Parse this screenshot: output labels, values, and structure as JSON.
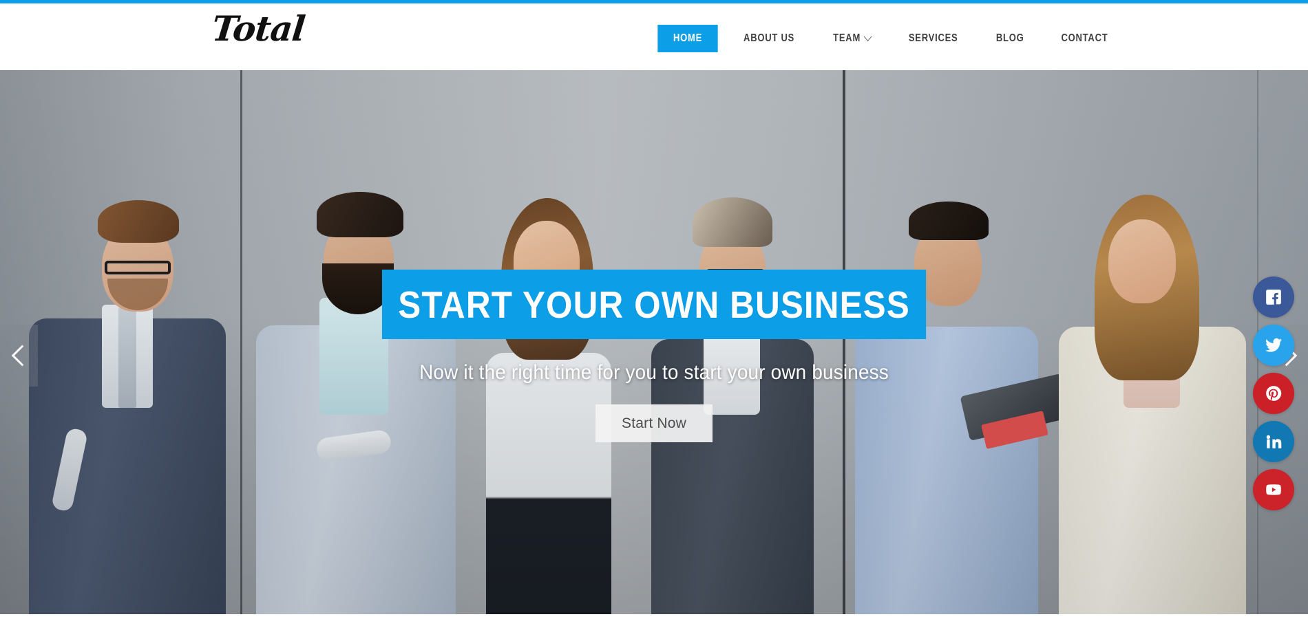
{
  "theme": {
    "accent_blue": "#0d9ee8",
    "nav_text": "#3f3f3f",
    "hero_title_bg": "#0d9ee8",
    "cta_bg": "#f3f3f3",
    "cta_text": "#4d4d4d"
  },
  "header": {
    "brand": "Total",
    "nav": [
      {
        "label": "HOME",
        "active": true,
        "has_dropdown": false
      },
      {
        "label": "ABOUT US",
        "active": false,
        "has_dropdown": false
      },
      {
        "label": "TEAM",
        "active": false,
        "has_dropdown": true
      },
      {
        "label": "SERVICES",
        "active": false,
        "has_dropdown": false
      },
      {
        "label": "BLOG",
        "active": false,
        "has_dropdown": false
      },
      {
        "label": "CONTACT",
        "active": false,
        "has_dropdown": false
      }
    ]
  },
  "hero": {
    "title": "START YOUR OWN BUSINESS",
    "subtitle": "Now it the right time for you to start your own business",
    "cta_label": "Start Now",
    "prev_icon": "chevron-left-icon",
    "next_icon": "chevron-right-icon"
  },
  "social": [
    {
      "name": "facebook",
      "color": "#3b5998"
    },
    {
      "name": "twitter",
      "color": "#29a3eb"
    },
    {
      "name": "pinterest",
      "color": "#cb2027"
    },
    {
      "name": "linkedin",
      "color": "#1178b3"
    },
    {
      "name": "youtube",
      "color": "#cc2229"
    }
  ]
}
